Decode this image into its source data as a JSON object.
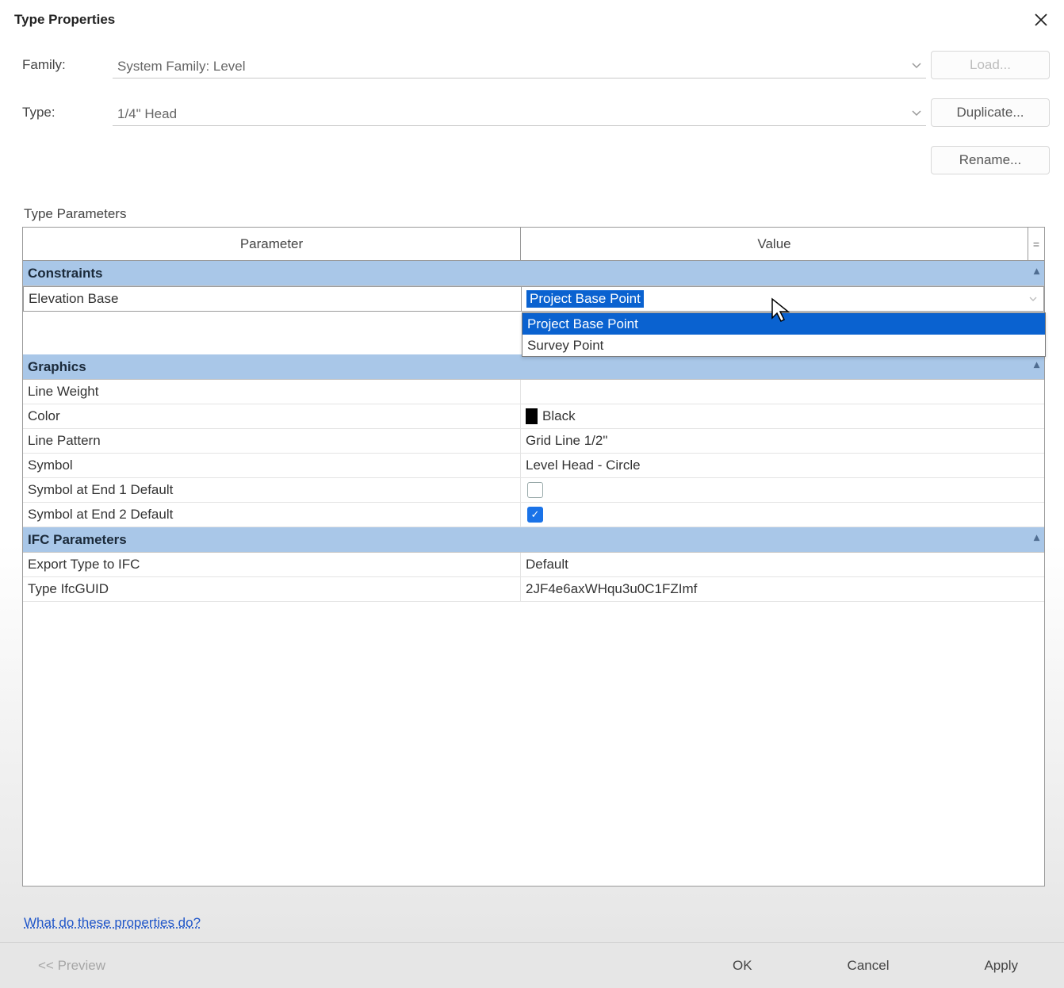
{
  "title": "Type Properties",
  "header": {
    "family_label": "Family:",
    "family_value": "System Family: Level",
    "type_label": "Type:",
    "type_value": "1/4\" Head",
    "load_btn": "Load...",
    "duplicate_btn": "Duplicate...",
    "rename_btn": "Rename..."
  },
  "type_params_label": "Type Parameters",
  "table": {
    "col_parameter": "Parameter",
    "col_value": "Value",
    "col_eq": "="
  },
  "groups": {
    "constraints": {
      "label": "Constraints",
      "rows": [
        {
          "param": "Elevation Base",
          "value": "Project Base Point",
          "active": true
        }
      ]
    },
    "graphics": {
      "label": "Graphics",
      "rows": [
        {
          "param": "Line Weight",
          "value": ""
        },
        {
          "param": "Color",
          "value": "Black",
          "color_swatch": "#000000"
        },
        {
          "param": "Line Pattern",
          "value": "Grid Line 1/2\""
        },
        {
          "param": "Symbol",
          "value": "Level Head - Circle"
        },
        {
          "param": "Symbol at End 1 Default",
          "checkbox": false
        },
        {
          "param": "Symbol at End 2 Default",
          "checkbox": true
        }
      ]
    },
    "ifc": {
      "label": "IFC Parameters",
      "rows": [
        {
          "param": "Export Type to IFC",
          "value": "Default"
        },
        {
          "param": "Type IfcGUID",
          "value": "2JF4e6axWHqu3u0C1FZImf"
        }
      ]
    }
  },
  "dropdown": {
    "options": [
      {
        "label": "Project Base Point",
        "selected": true
      },
      {
        "label": "Survey Point",
        "selected": false
      }
    ]
  },
  "help_link": "What do these properties do?",
  "footer": {
    "preview": "<< Preview",
    "ok": "OK",
    "cancel": "Cancel",
    "apply": "Apply"
  }
}
